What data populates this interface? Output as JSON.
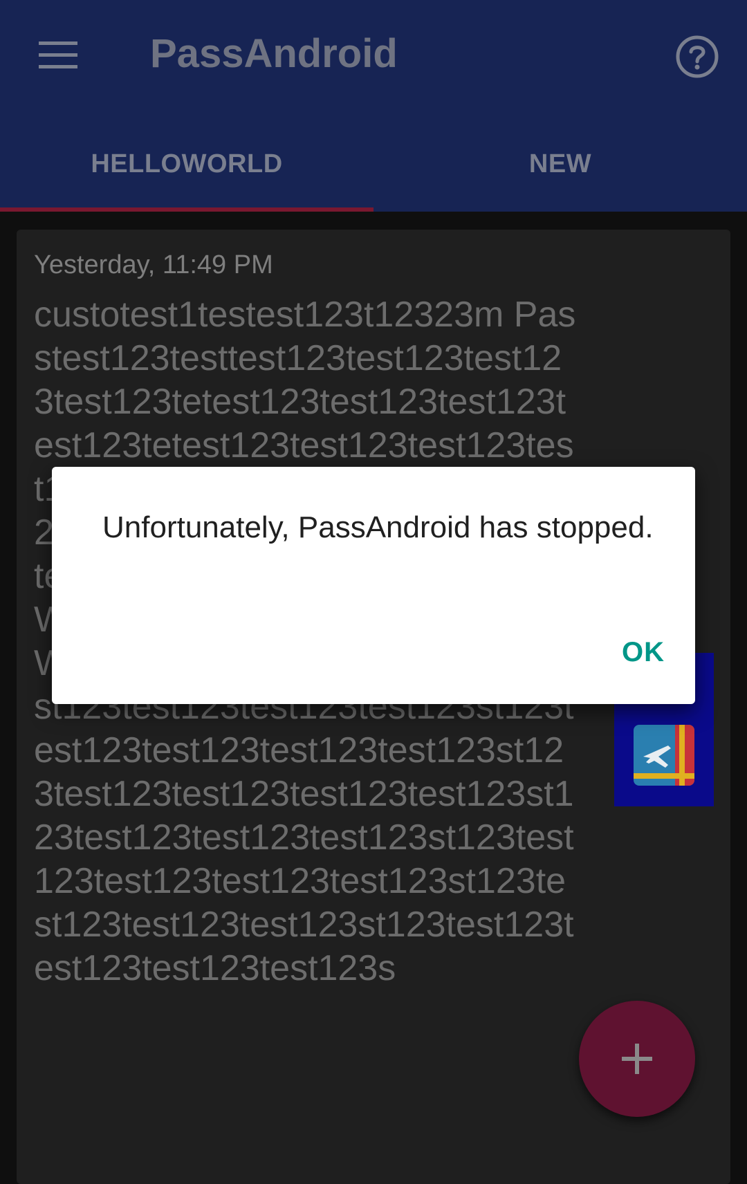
{
  "app_bar": {
    "menu_icon": "hamburger-menu-icon",
    "title": "PassAndroid",
    "help_icon": "help-circle-icon"
  },
  "tabs": [
    {
      "label": "HELLOWORLD",
      "selected": true
    },
    {
      "label": "NEW",
      "selected": false
    }
  ],
  "pass_card": {
    "timestamp": "Yesterday, 11:49 PM",
    "description": "custotest1testest123t12323m Passtest123testtest123test123test123test123tetest123test123test123test123tetest123test123test123test123tetest123test123test123test123tetest123test123test123test123test123test123teHelloWorldHelloWorldHelloWorldHelloWorldHelloWorldtest123HelloWorldtest123test123test123test123test123st123test123test123test123test123st123test123test123test123test123st123test123test123test123st123test123test123test123test123st123test123test123test123st123test123test123test123test123s",
    "thumbnail_icon": "airplane-ticket-icon"
  },
  "dialog": {
    "message": "Unfortunately, PassAndroid has stopped.",
    "ok_label": "OK"
  },
  "fab": {
    "icon": "plus-icon"
  },
  "colors": {
    "app_bar": "#172454",
    "tab_indicator": "#7a1830",
    "fab": "#5f1230",
    "dialog_button": "#009688"
  }
}
